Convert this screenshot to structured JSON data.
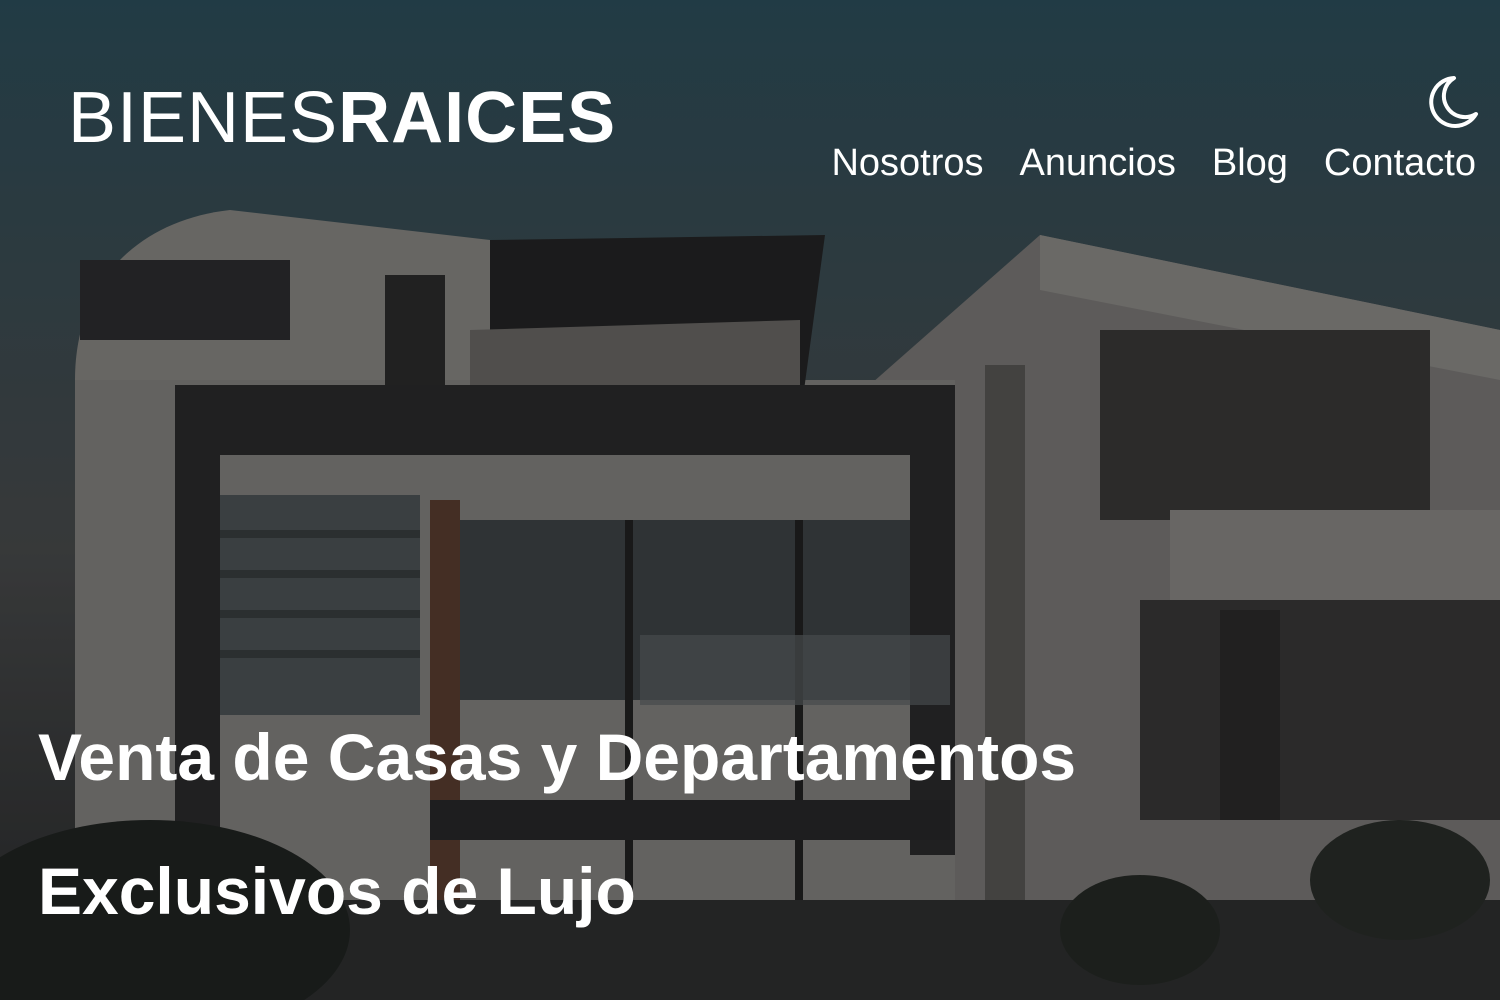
{
  "header": {
    "logo_light": "BIENES",
    "logo_bold": "RAICES",
    "nav": [
      {
        "label": "Nosotros"
      },
      {
        "label": "Anuncios"
      },
      {
        "label": "Blog"
      },
      {
        "label": "Contacto"
      }
    ],
    "dark_mode_icon": "moon-icon"
  },
  "hero": {
    "background": "modern-house-photo",
    "headline": "Venta de Casas y Departamentos Exclusivos de Lujo"
  },
  "colors": {
    "text": "#ffffff",
    "sky": "#2d4f5c",
    "overlay": "rgba(0,0,0,0.25)"
  }
}
